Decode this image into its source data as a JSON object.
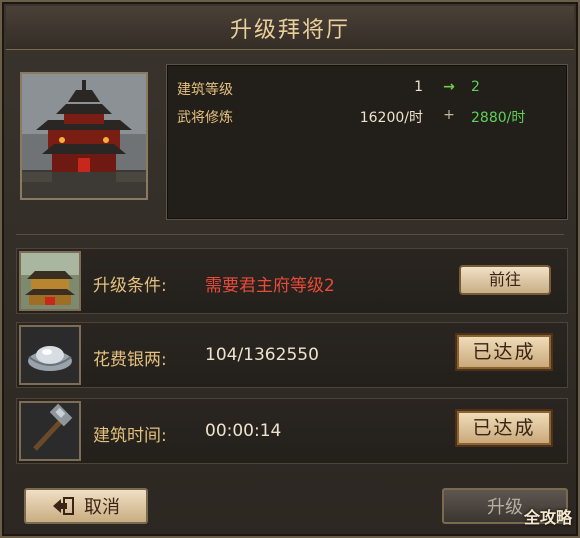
{
  "title": "升级拜将厅",
  "building_info": {
    "rows": [
      {
        "label": "建筑等级",
        "from": "1",
        "op": "→",
        "to": "2"
      },
      {
        "label": "武将修炼",
        "from": "16200/时",
        "op": "+",
        "to": "2880/时"
      }
    ]
  },
  "requirements": [
    {
      "icon": "palace-building-icon",
      "label": "升级条件:",
      "value": "需要君主府等级2",
      "button": "前往"
    },
    {
      "icon": "silver-ingot-icon",
      "label": "花费银两:",
      "value": "104/1362550",
      "button": "已达成"
    },
    {
      "icon": "hammer-icon",
      "label": "建筑时间:",
      "value": "00:00:14",
      "button": "已达成"
    }
  ],
  "footer": {
    "cancel_label": "取消",
    "upgrade_label": "升级"
  },
  "watermark": "全攻略",
  "colors": {
    "title": "#e9cf9a",
    "label_gold": "#e3c07e",
    "increase_green": "#5fd15a",
    "requirement_red": "#e94a3a"
  }
}
